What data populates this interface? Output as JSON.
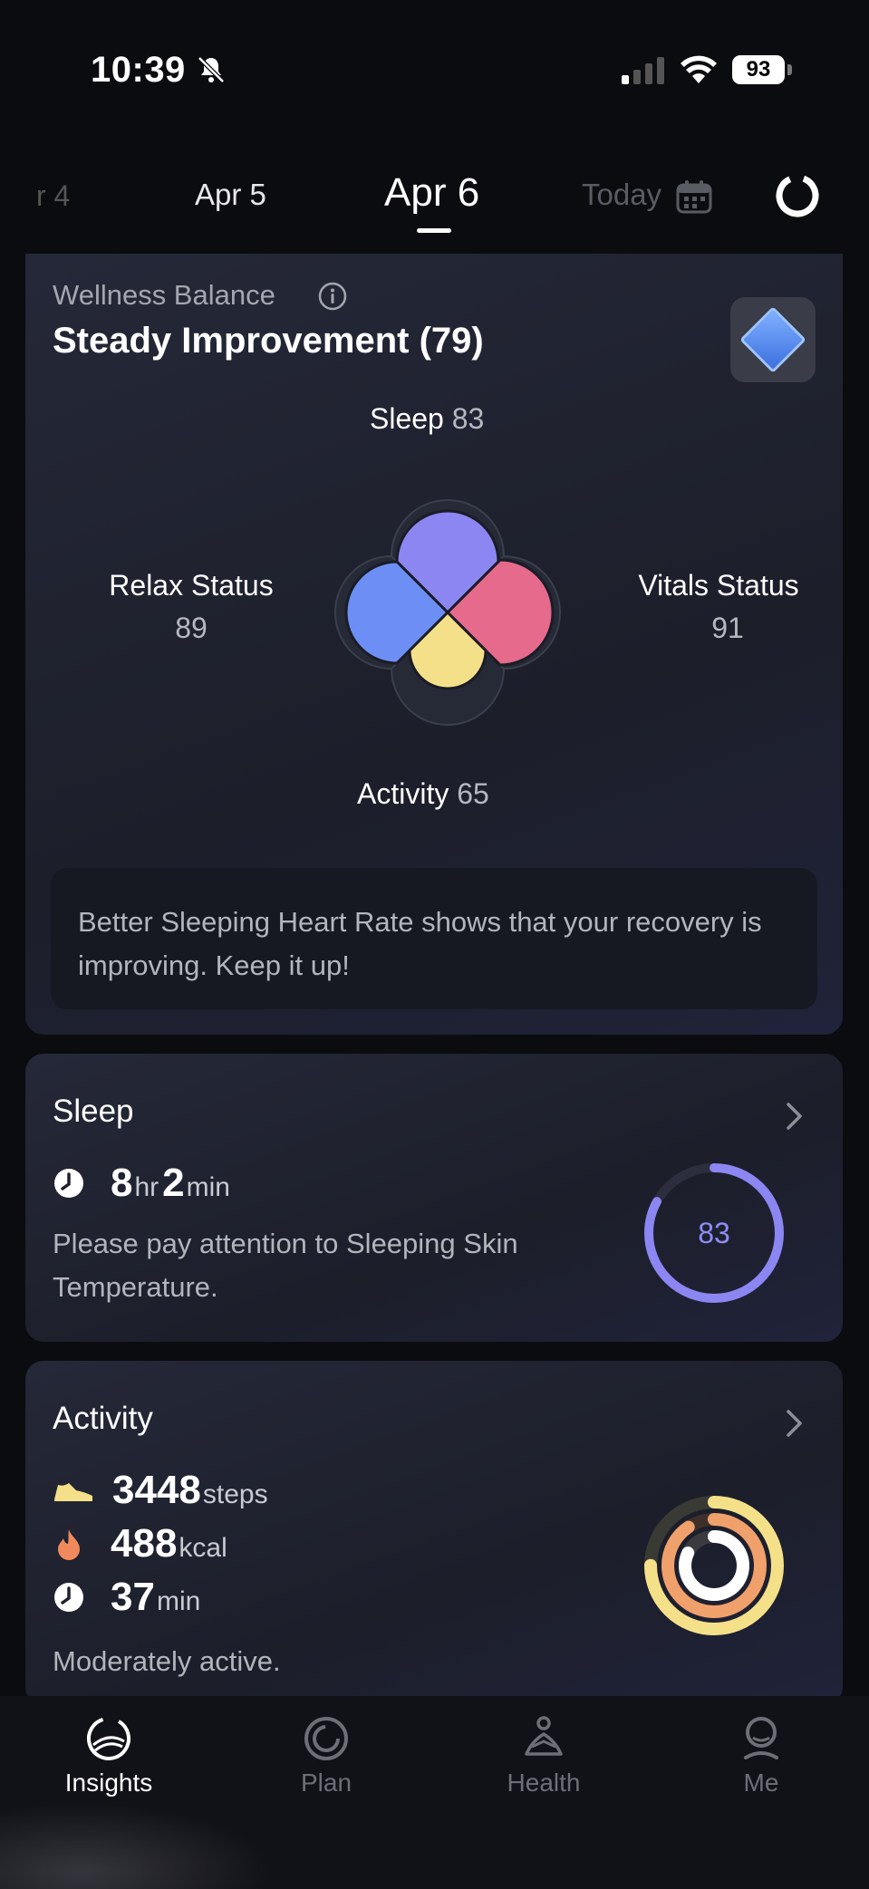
{
  "status_bar": {
    "time": "10:39",
    "battery": "93"
  },
  "date_nav": {
    "prev2": "r 4",
    "prev": "Apr 5",
    "current": "Apr 6",
    "today": "Today"
  },
  "wellness": {
    "subtitle": "Wellness Balance",
    "title": "Steady Improvement (79)",
    "sleep_label": "Sleep",
    "sleep_value": "83",
    "activity_label": "Activity",
    "activity_value": "65",
    "relax_label": "Relax Status",
    "relax_value": "89",
    "vitals_label": "Vitals Status",
    "vitals_value": "91",
    "message": "Better Sleeping Heart Rate shows that your recovery is improving. Keep it up!",
    "colors": {
      "sleep": "#8b86f2",
      "relax": "#6d8ff5",
      "vitals": "#e56a8c",
      "activity": "#f5e08a"
    }
  },
  "sleep_card": {
    "title": "Sleep",
    "hours": "8",
    "hours_unit": "hr",
    "minutes": "2",
    "minutes_unit": "min",
    "text": "Please pay attention to Sleeping Skin Temperature.",
    "score": "83",
    "score_fraction": 0.83
  },
  "activity_card": {
    "title": "Activity",
    "steps": "3448",
    "steps_unit": "steps",
    "kcal": "488",
    "kcal_unit": "kcal",
    "minutes": "37",
    "minutes_unit": "min",
    "text": "Moderately active."
  },
  "tabs": [
    {
      "label": "Insights",
      "icon": "insights-icon",
      "active": true
    },
    {
      "label": "Plan",
      "icon": "plan-icon",
      "active": false
    },
    {
      "label": "Health",
      "icon": "health-icon",
      "active": false
    },
    {
      "label": "Me",
      "icon": "me-icon",
      "active": false
    }
  ]
}
